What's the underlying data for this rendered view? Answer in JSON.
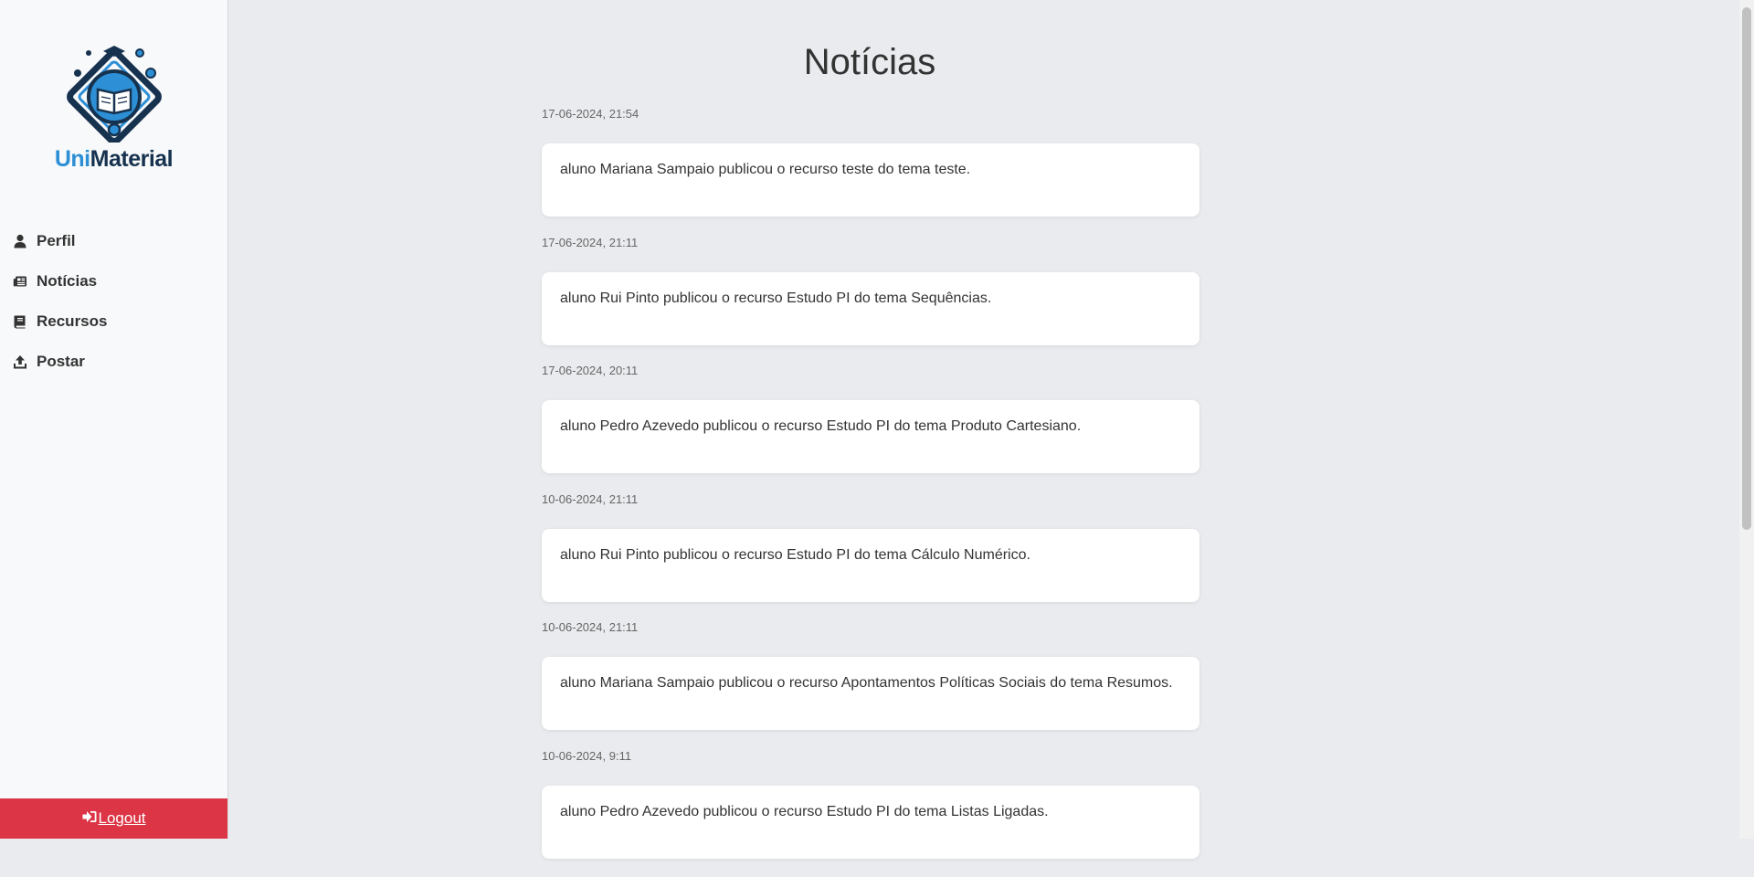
{
  "brand": {
    "name_part1": "Uni",
    "name_part2": "Material"
  },
  "nav": {
    "items": [
      {
        "label": "Perfil",
        "icon": "user-icon"
      },
      {
        "label": "Notícias",
        "icon": "newspaper-icon"
      },
      {
        "label": "Recursos",
        "icon": "book-icon"
      },
      {
        "label": "Postar",
        "icon": "upload-icon"
      }
    ],
    "logout_label": "Logout"
  },
  "page": {
    "title": "Notícias"
  },
  "news": [
    {
      "date": "17-06-2024, 21:54",
      "text": "aluno Mariana Sampaio publicou o recurso teste do tema teste."
    },
    {
      "date": "17-06-2024, 21:11",
      "text": "aluno Rui Pinto publicou o recurso Estudo PI do tema Sequências."
    },
    {
      "date": "17-06-2024, 20:11",
      "text": "aluno Pedro Azevedo publicou o recurso Estudo PI do tema Produto Cartesiano."
    },
    {
      "date": "10-06-2024, 21:11",
      "text": "aluno Rui Pinto publicou o recurso Estudo PI do tema Cálculo Numérico."
    },
    {
      "date": "10-06-2024, 21:11",
      "text": "aluno Mariana Sampaio publicou o recurso Apontamentos Políticas Sociais do tema Resumos."
    },
    {
      "date": "10-06-2024, 9:11",
      "text": "aluno Pedro Azevedo publicou o recurso Estudo PI do tema Listas Ligadas."
    }
  ],
  "colors": {
    "accent": "#2d8fd5",
    "logout": "#dc3545",
    "background": "#e9ebee"
  }
}
